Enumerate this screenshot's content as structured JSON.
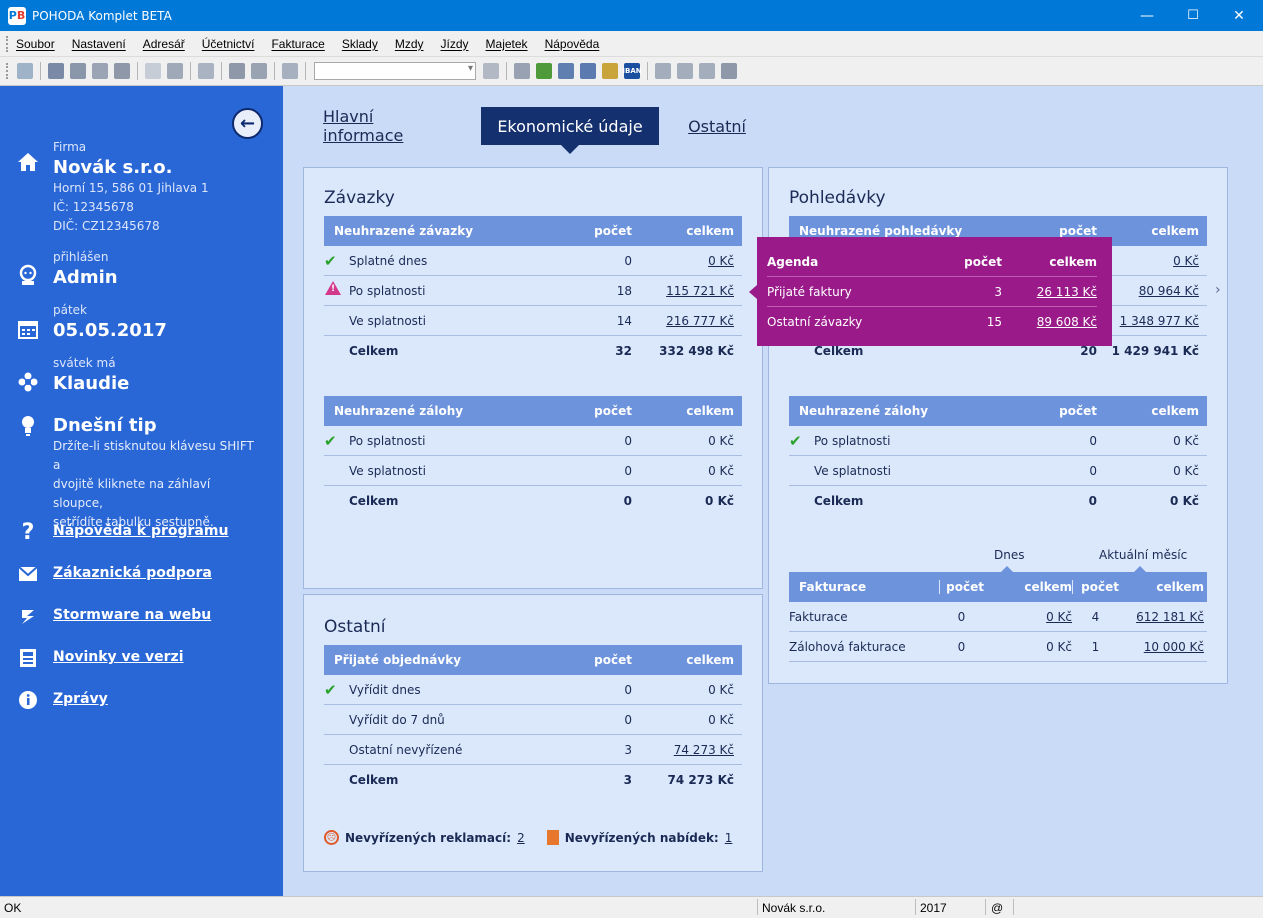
{
  "window": {
    "title": "POHODA Komplet BETA",
    "minimize": "—",
    "maximize": "☐",
    "close": "✕"
  },
  "menu": [
    "Soubor",
    "Nastavení",
    "Adresář",
    "Účetnictví",
    "Fakturace",
    "Sklady",
    "Mzdy",
    "Jízdy",
    "Majetek",
    "Nápověda"
  ],
  "toolbar": {
    "iban_label": "IBAN"
  },
  "sidebar": {
    "firm_label": "Firma",
    "firm_name": "Novák s.r.o.",
    "firm_address": "Horní 15, 586 01 Jihlava 1",
    "firm_ic": "IČ: 12345678",
    "firm_dic": "DIČ: CZ12345678",
    "user_label": "přihlášen",
    "user_name": "Admin",
    "day_label": "pátek",
    "date": "05.05.2017",
    "nameday_label": "svátek má",
    "nameday_name": "Klaudie",
    "tip_title": "Dnešní tip",
    "tip_line1": "Držíte-li stisknutou klávesu SHIFT a",
    "tip_line2": "dvojitě kliknete na záhlaví sloupce,",
    "tip_line3": "setřídíte tabulku sestupně.",
    "links": [
      "Nápověda k programu",
      "Zákaznická podpora",
      "Stormware na webu",
      "Novinky ve verzi",
      "Zprávy"
    ]
  },
  "tabs": {
    "main_info": "Hlavní informace",
    "economic": "Ekonomické údaje",
    "other": "Ostatní"
  },
  "zavazky": {
    "title": "Závazky",
    "unpaid": {
      "header": "Neuhrazené závazky",
      "col_count": "počet",
      "col_total": "celkem",
      "rows": [
        {
          "label": "Splatné dnes",
          "count": "0",
          "total": "0 Kč"
        },
        {
          "label": "Po splatnosti",
          "count": "18",
          "total": "115 721 Kč"
        },
        {
          "label": "Ve splatnosti",
          "count": "14",
          "total": "216 777 Kč"
        },
        {
          "label": "Celkem",
          "count": "32",
          "total": "332 498 Kč"
        }
      ]
    },
    "advances": {
      "header": "Neuhrazené zálohy",
      "col_count": "počet",
      "col_total": "celkem",
      "rows": [
        {
          "label": "Po splatnosti",
          "count": "0",
          "total": "0 Kč"
        },
        {
          "label": "Ve splatnosti",
          "count": "0",
          "total": "0 Kč"
        },
        {
          "label": "Celkem",
          "count": "0",
          "total": "0 Kč"
        }
      ]
    }
  },
  "pohledavky": {
    "title": "Pohledávky",
    "unpaid": {
      "header": "Neuhrazené pohledávky",
      "col_count": "počet",
      "col_total": "celkem",
      "rows": [
        {
          "label": "",
          "count": "",
          "total": "0 Kč"
        },
        {
          "label": "",
          "count": "",
          "total": "80 964 Kč"
        },
        {
          "label": "",
          "count": "",
          "total": "1 348 977 Kč"
        },
        {
          "label": "Celkem",
          "count": "20",
          "total": "1 429 941 Kč"
        }
      ]
    },
    "advances": {
      "header": "Neuhrazené zálohy",
      "col_count": "počet",
      "col_total": "celkem",
      "rows": [
        {
          "label": "Po splatnosti",
          "count": "0",
          "total": "0 Kč"
        },
        {
          "label": "Ve splatnosti",
          "count": "0",
          "total": "0 Kč"
        },
        {
          "label": "Celkem",
          "count": "0",
          "total": "0 Kč"
        }
      ]
    },
    "invoicing": {
      "today_label": "Dnes",
      "month_label": "Aktuální měsíc",
      "header": "Fakturace",
      "col_count": "počet",
      "col_total": "celkem",
      "rows": [
        {
          "label": "Fakturace",
          "today_count": "0",
          "today_total": "0 Kč",
          "month_count": "4",
          "month_total": "612 181 Kč"
        },
        {
          "label": "Zálohová fakturace",
          "today_count": "0",
          "today_total": "0 Kč",
          "month_count": "1",
          "month_total": "10 000 Kč"
        }
      ]
    }
  },
  "popup": {
    "col_agenda": "Agenda",
    "col_count": "počet",
    "col_total": "celkem",
    "rows": [
      {
        "label": "Přijaté faktury",
        "count": "3",
        "total": "26 113 Kč"
      },
      {
        "label": "Ostatní závazky",
        "count": "15",
        "total": "89 608 Kč"
      }
    ]
  },
  "ostatni": {
    "title": "Ostatní",
    "orders": {
      "header": "Přijaté objednávky",
      "col_count": "počet",
      "col_total": "celkem",
      "rows": [
        {
          "label": "Vyřídit dnes",
          "count": "0",
          "total": "0 Kč"
        },
        {
          "label": "Vyřídit do 7 dnů",
          "count": "0",
          "total": "0 Kč"
        },
        {
          "label": "Ostatní nevyřízené",
          "count": "3",
          "total": "74 273 Kč"
        },
        {
          "label": "Celkem",
          "count": "3",
          "total": "74 273 Kč"
        }
      ]
    },
    "complaints_label": "Nevyřízených reklamací:",
    "complaints_value": "2",
    "offers_label": "Nevyřízených nabídek:",
    "offers_value": "1"
  },
  "status": {
    "left": "OK",
    "firm": "Novák s.r.o.",
    "year": "2017",
    "at": "@"
  },
  "colors": {
    "sidebar": "#2a67d6",
    "main_bg": "#c9dbf6",
    "table_header": "#6d93dd",
    "active_tab": "#14306f",
    "popup": "#9a1a8a"
  }
}
